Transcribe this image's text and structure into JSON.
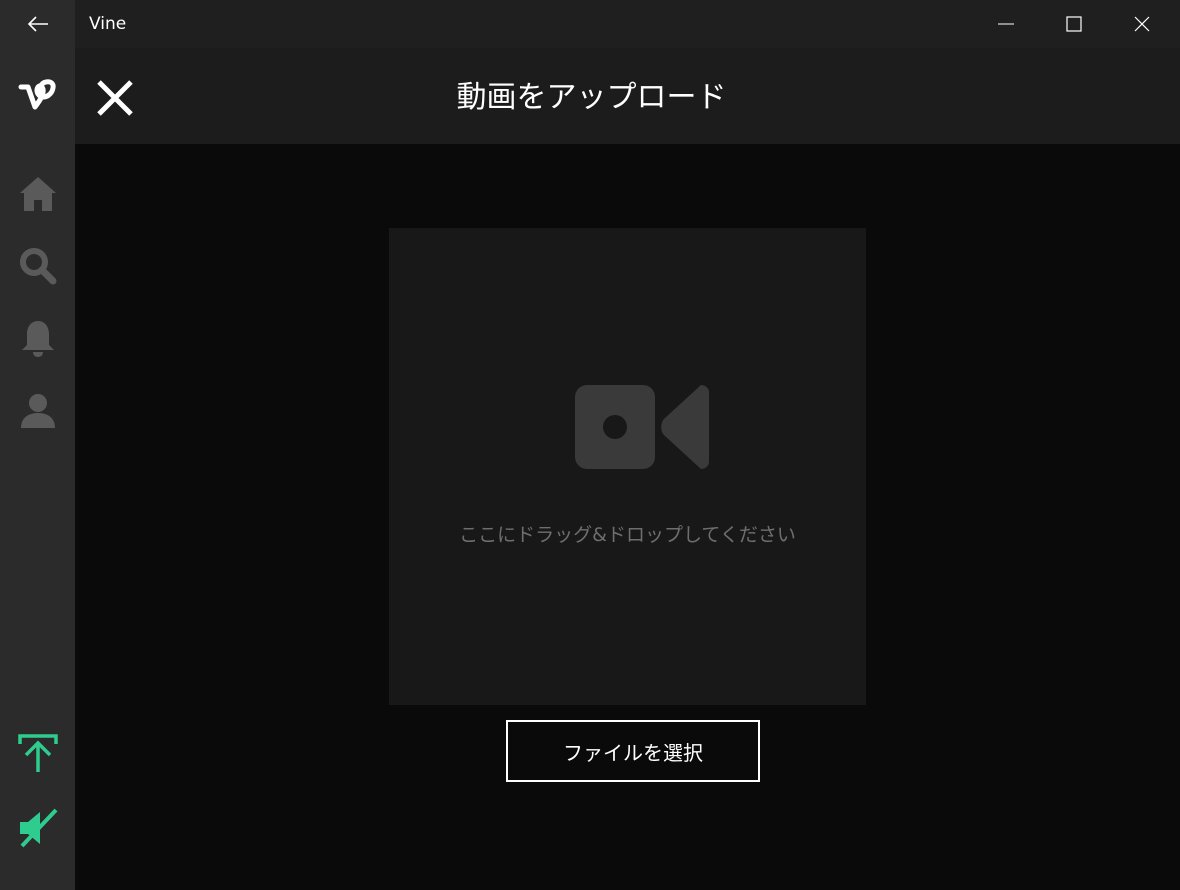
{
  "window": {
    "title": "Vine",
    "controls": [
      "minimize-icon",
      "maximize-icon",
      "close-icon"
    ]
  },
  "sidebar": {
    "logo": "vine-logo",
    "items": [
      {
        "icon": "home-icon"
      },
      {
        "icon": "search-icon"
      },
      {
        "icon": "bell-icon"
      },
      {
        "icon": "user-icon"
      }
    ],
    "bottom_items": [
      {
        "icon": "upload-icon"
      },
      {
        "icon": "mute-icon"
      }
    ],
    "accent_color": "#2ecc8f"
  },
  "header": {
    "title": "動画をアップロード"
  },
  "dropzone": {
    "icon": "video-camera-icon",
    "hint": "ここにドラッグ&ドロップしてください"
  },
  "actions": {
    "select_file_label": "ファイルを選択"
  }
}
